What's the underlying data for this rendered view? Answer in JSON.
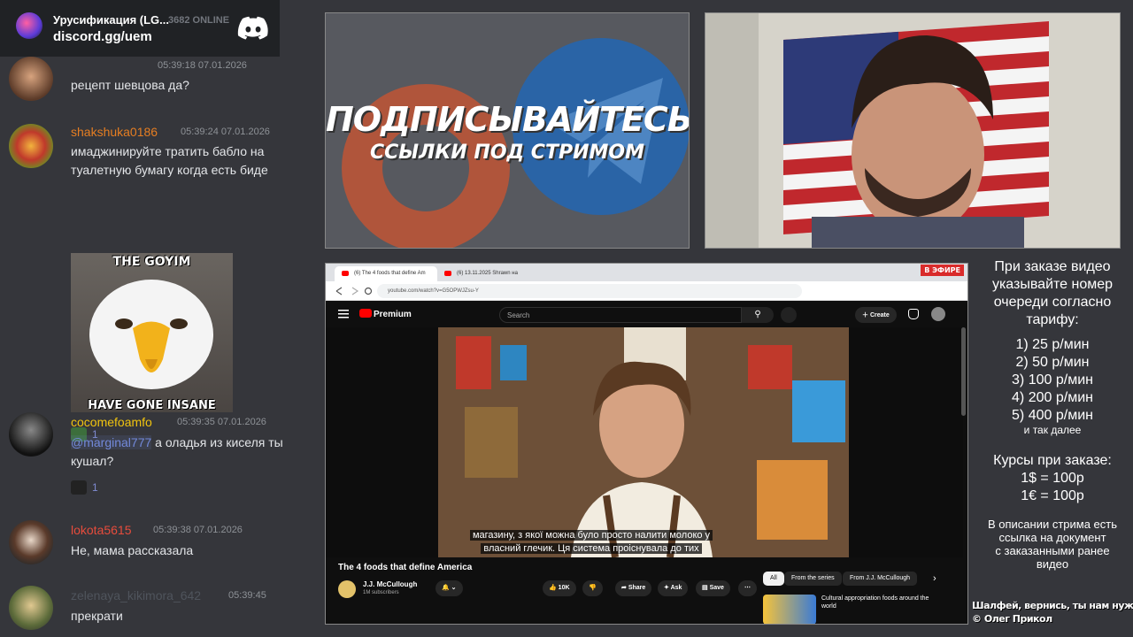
{
  "discord": {
    "server_name": "Урусификация (LG...",
    "online": "3682 ONLINE",
    "invite": "discord.gg/uem"
  },
  "messages": [
    {
      "name": "",
      "time": "05:39:18 07.01.2026",
      "text": "рецепт шевцова да?"
    },
    {
      "name": "shakshuka0186",
      "time": "05:39:24 07.01.2026",
      "text": "имаджинируйте тратить бабло на туалетную бумагу когда есть биде",
      "meme_top": "THE GOYIM",
      "meme_bottom": "HAVE GONE INSANE",
      "reaction_count": "1"
    },
    {
      "name": "cocomefoamfo",
      "time": "05:39:35 07.01.2026",
      "mention": "@marginal777",
      "text": " а оладья из киселя ты кушал?",
      "reaction_count": "1"
    },
    {
      "name": "lokota5615",
      "time": "05:39:38 07.01.2026",
      "text": "Не, мама рассказала"
    },
    {
      "name": "zelenaya_kikimora_642",
      "time": "05:39:45",
      "text": "прекрати"
    }
  ],
  "banner": {
    "title": "ПОДПИСЫВАЙТЕСЬ",
    "subtitle": "ССЫЛКИ ПОД СТРИМОМ"
  },
  "browser": {
    "tab1": "(6) The 4 foods that define Am",
    "tab2": "(6) 13.11.2025 Shrawn на",
    "live_badge": "В ЭФИРЕ",
    "url": "youtube.com/watch?v=G5OPWJZsu-Y",
    "yt_brand": "Premium",
    "search_placeholder": "Search",
    "create_label": "Create",
    "subtitles_line1": "магазину, з якої можна було просто налити молоко у",
    "subtitles_line2": "власний глечик. Ця система проіснувала до тих",
    "video_title": "The 4 foods that define America",
    "channel": "J.J. McCullough",
    "subscribers": "1M subscribers",
    "likes": "10K",
    "share": "Share",
    "ask": "Ask",
    "save": "Save",
    "chips": [
      "All",
      "From the series",
      "From J.J. McCullough"
    ],
    "rec_title": "Cultural appropriation foods around the world"
  },
  "info": {
    "order_text": [
      "При заказе видео",
      "указывайте номер",
      "очереди согласно",
      "тарифу:"
    ],
    "tariffs": [
      "1) 25 р/мин",
      "2) 50 р/мин",
      "3) 100 р/мин",
      "4) 200 р/мин",
      "5) 400 р/мин"
    ],
    "and_more": "и так далее",
    "rates_title": "Курсы при заказе:",
    "rates": [
      "1$ = 100р",
      "1€ = 100р"
    ],
    "description": [
      "В описании стрима есть",
      "ссылка на документ",
      "с заказанными ранее",
      "видео"
    ]
  },
  "footer": {
    "line1": "Шалфей, вернись, ты нам нужен.",
    "line2": "© Олег Прикол"
  },
  "colors": {
    "name_shakshuka": "#e67e22",
    "name_cocomefoamfo": "#f1c40f",
    "name_lokota": "#e74c3c",
    "name_grey": "#4f545c"
  }
}
